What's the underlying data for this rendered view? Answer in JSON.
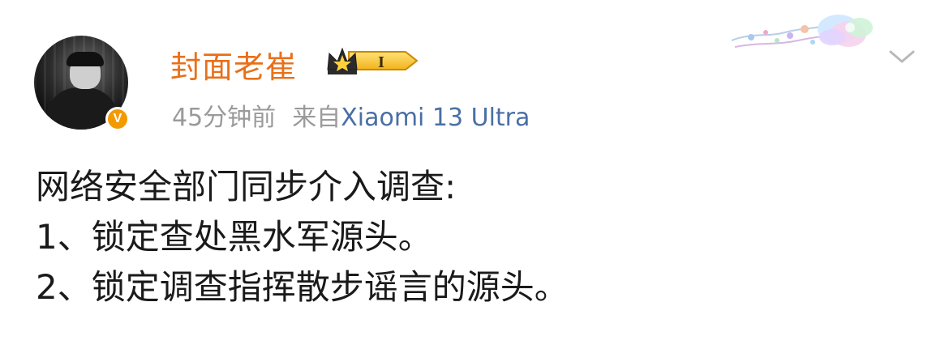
{
  "post": {
    "author": {
      "name": "封面老崔",
      "vip_level": "I",
      "verified_mark": "V"
    },
    "meta": {
      "time": "45分钟前",
      "source_prefix": "来自",
      "device": "Xiaomi 13 Ultra"
    },
    "content": {
      "lines": [
        "网络安全部门同步介入调查:",
        "1、锁定查处黑水军源头。",
        "2、锁定调查指挥散步谣言的源头。"
      ]
    }
  },
  "icons": {
    "verified": "verified-v-badge-icon",
    "vip": "crown-vip-badge-icon",
    "decoration": "floral-card-decoration-icon",
    "more": "chevron-down-icon"
  },
  "colors": {
    "username": "#e8701a",
    "device_link": "#4a6fa5",
    "meta_gray": "#9a9a9a",
    "badge_orange": "#f29a00"
  }
}
